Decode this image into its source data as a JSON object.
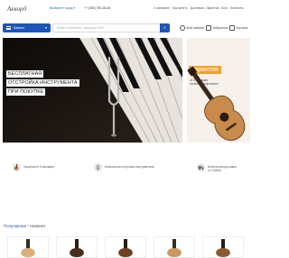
{
  "header": {
    "logo": "Аккорд",
    "city_prompt": "Выберите город",
    "city_chevron": "▾",
    "phone": "+7 (351) 750-26-46",
    "links": [
      "О магазине",
      "Как купить",
      "Доставка",
      "Гарантия",
      "Блог",
      "Контакты"
    ]
  },
  "nav": {
    "catalog_label": "Каталог",
    "catalog_chevron": "▾",
    "search_placeholder": "Искать в магазине, например, ЕК57",
    "search_icon": "⌕",
    "account_label": "Мой кабинет",
    "favorites_label": "Избранное",
    "cart_label": "Корзина"
  },
  "banner_main": {
    "line1": "БЕСПЛАТНАЯ",
    "line2": "ОТСТРОЙКА ИНСТРУМЕНТА",
    "line3": "ПРИ ПОКУПКЕ"
  },
  "banner_side": {
    "title": "Гарантия",
    "sub1": "от 6 месяцев",
    "sub2": "на весь ассортимент"
  },
  "features": [
    {
      "icon": "guitar-icon",
      "text": "Гарантия от 6 месяцев"
    },
    {
      "icon": "tuning-icon",
      "text": "Бесплатная отстройка инструментов"
    },
    {
      "icon": "delivery-icon",
      "text": "Бесплатная доставка",
      "text2": "от 10000р"
    }
  ],
  "product_tabs": {
    "active": "Популярные",
    "separator": "/",
    "inactive": "Новинки"
  },
  "colors": {
    "accent": "#1e55b8",
    "banner_dark": "#1b1613",
    "guarantee_orange": "#f0a12a"
  }
}
